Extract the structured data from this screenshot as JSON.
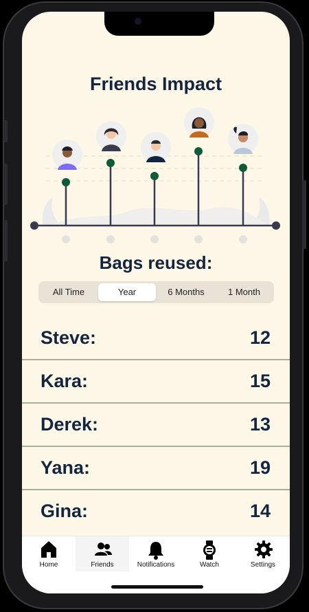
{
  "page": {
    "title": "Friends Impact"
  },
  "section": {
    "subtitle": "Bags reused:"
  },
  "tabs": [
    {
      "label": "All Time",
      "active": false
    },
    {
      "label": "Year",
      "active": true
    },
    {
      "label": "6 Months",
      "active": false
    },
    {
      "label": "1 Month",
      "active": false
    }
  ],
  "friends": [
    {
      "name": "Steve:",
      "bags": "12"
    },
    {
      "name": "Kara:",
      "bags": "15"
    },
    {
      "name": "Derek:",
      "bags": "13"
    },
    {
      "name": "Yana:",
      "bags": "19"
    },
    {
      "name": "Gina:",
      "bags": "14"
    }
  ],
  "nav": [
    {
      "label": "Home",
      "icon": "home-icon",
      "active": false
    },
    {
      "label": "Friends",
      "icon": "friends-icon",
      "active": true
    },
    {
      "label": "Notifications",
      "icon": "bell-icon",
      "active": false
    },
    {
      "label": "Watch",
      "icon": "watch-icon",
      "active": false
    },
    {
      "label": "Settings",
      "icon": "gear-icon",
      "active": false
    }
  ],
  "colors": {
    "background": "#fdf7e8",
    "text": "#14263f",
    "dot": "#0f5a37",
    "axis": "#3a3a4e"
  }
}
